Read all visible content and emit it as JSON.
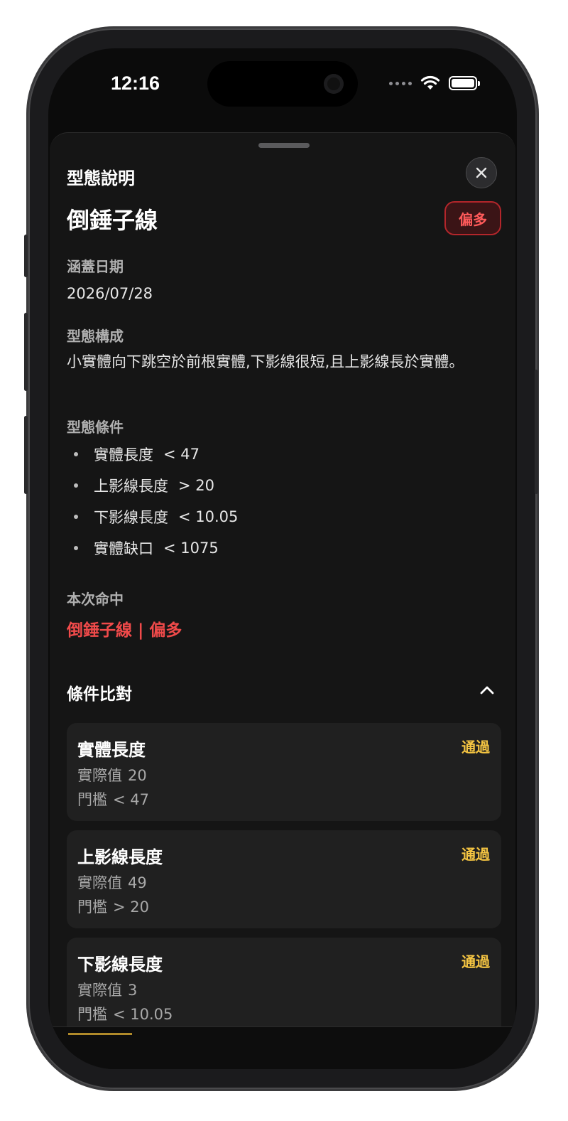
{
  "status_bar": {
    "time": "12:16"
  },
  "sheet": {
    "title": "型態說明",
    "pattern_name": "倒錘子線",
    "bias_badge": "偏多",
    "date_label": "涵蓋日期",
    "date_value": "2026/07/28",
    "composition_label": "型態構成",
    "composition_text": "小實體向下跳空於前根實體,下影線很短,且上影線長於實體。",
    "conditions_label": "型態條件",
    "conditions": [
      {
        "name": "實體長度",
        "rule": "< 47"
      },
      {
        "name": "上影線長度",
        "rule": "> 20"
      },
      {
        "name": "下影線長度",
        "rule": "< 10.05"
      },
      {
        "name": "實體缺口",
        "rule": "< 1075"
      }
    ],
    "hit_label": "本次命中",
    "hit_value": "倒錘子線 | 偏多",
    "comparison_title": "條件比對",
    "comparison": [
      {
        "title": "實體長度",
        "status": "通過",
        "actual_label": "實際值",
        "actual": "20",
        "threshold_label": "門檻",
        "threshold": "< 47"
      },
      {
        "title": "上影線長度",
        "status": "通過",
        "actual_label": "實際值",
        "actual": "49",
        "threshold_label": "門檻",
        "threshold": "> 20"
      },
      {
        "title": "下影線長度",
        "status": "通過",
        "actual_label": "實際值",
        "actual": "3",
        "threshold_label": "門檻",
        "threshold": "< 10.05"
      }
    ]
  },
  "colors": {
    "accent_red": "#f04a4a",
    "pass_yellow": "#f5c542",
    "sheet_bg": "#151515",
    "card_bg": "#202020"
  },
  "icons": [
    "close-icon",
    "chevron-up-icon",
    "wifi-icon",
    "battery-icon",
    "signal-dots-icon"
  ]
}
